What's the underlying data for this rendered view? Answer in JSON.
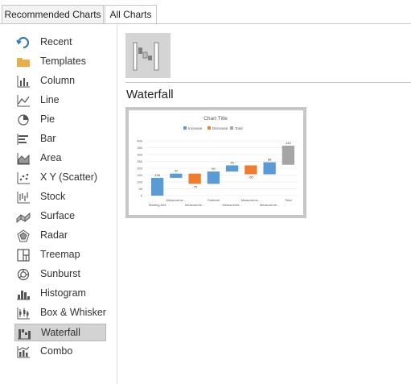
{
  "tabs": [
    {
      "label": "Recommended Charts",
      "selected": false
    },
    {
      "label": "All Charts",
      "selected": true
    }
  ],
  "sidebar": {
    "items": [
      {
        "label": "Recent",
        "icon": "recent-icon"
      },
      {
        "label": "Templates",
        "icon": "folder-icon"
      },
      {
        "label": "Column",
        "icon": "column-chart-icon"
      },
      {
        "label": "Line",
        "icon": "line-chart-icon"
      },
      {
        "label": "Pie",
        "icon": "pie-chart-icon"
      },
      {
        "label": "Bar",
        "icon": "bar-chart-icon"
      },
      {
        "label": "Area",
        "icon": "area-chart-icon"
      },
      {
        "label": "X Y (Scatter)",
        "icon": "scatter-chart-icon"
      },
      {
        "label": "Stock",
        "icon": "stock-chart-icon"
      },
      {
        "label": "Surface",
        "icon": "surface-chart-icon"
      },
      {
        "label": "Radar",
        "icon": "radar-chart-icon"
      },
      {
        "label": "Treemap",
        "icon": "treemap-chart-icon"
      },
      {
        "label": "Sunburst",
        "icon": "sunburst-chart-icon"
      },
      {
        "label": "Histogram",
        "icon": "histogram-chart-icon"
      },
      {
        "label": "Box & Whisker",
        "icon": "box-whisker-chart-icon"
      },
      {
        "label": "Waterfall",
        "icon": "waterfall-chart-icon",
        "selected": true
      },
      {
        "label": "Combo",
        "icon": "combo-chart-icon"
      }
    ]
  },
  "main": {
    "subtype_icon": "waterfall-chart-icon",
    "heading": "Waterfall"
  },
  "colors": {
    "increase": "#5b9bd5",
    "decrease": "#ed7d31",
    "total": "#a5a5a5",
    "selected_bg": "#d3d3d3",
    "icon_blue": "#2e75b6",
    "folder": "#e8b04b"
  },
  "chart_data": {
    "type": "bar",
    "title": "Chart Title",
    "legend": [
      "Increase",
      "Decrease",
      "Total"
    ],
    "legend_position": "top",
    "ylim": [
      0,
      400
    ],
    "yticks": [
      0,
      50,
      100,
      150,
      200,
      250,
      300,
      350,
      400
    ],
    "categories": [
      "Starting Amt",
      "Measureme...",
      "Measureme...",
      "Subtotal",
      "Measureme...",
      "Measureme...",
      "Measureme...",
      "Total"
    ],
    "category_labels_row1": [
      "",
      "Measureme...",
      "",
      "Subtotal",
      "",
      "Measureme...",
      "",
      "Total"
    ],
    "category_labels_row2": [
      "Starting Amt",
      "",
      "Measureme...",
      "",
      "Measureme...",
      "",
      "Measureme...",
      ""
    ],
    "values": [
      130,
      31,
      -75,
      90,
      45,
      -65,
      88,
      140
    ],
    "value_labels": [
      "130",
      "31",
      "-75",
      "90",
      "45",
      "-65",
      "88",
      "140"
    ],
    "kinds": [
      "increase",
      "increase",
      "decrease",
      "increase",
      "increase",
      "decrease",
      "increase",
      "total"
    ],
    "bars": [
      {
        "low": 0,
        "high": 130,
        "kind": "increase"
      },
      {
        "low": 130,
        "high": 161,
        "kind": "increase"
      },
      {
        "low": 86,
        "high": 161,
        "kind": "decrease"
      },
      {
        "low": 86,
        "high": 176,
        "kind": "increase"
      },
      {
        "low": 176,
        "high": 221,
        "kind": "increase"
      },
      {
        "low": 156,
        "high": 221,
        "kind": "decrease"
      },
      {
        "low": 156,
        "high": 244,
        "kind": "increase"
      },
      {
        "low": 225,
        "high": 365,
        "kind": "total"
      }
    ],
    "grid": true
  }
}
